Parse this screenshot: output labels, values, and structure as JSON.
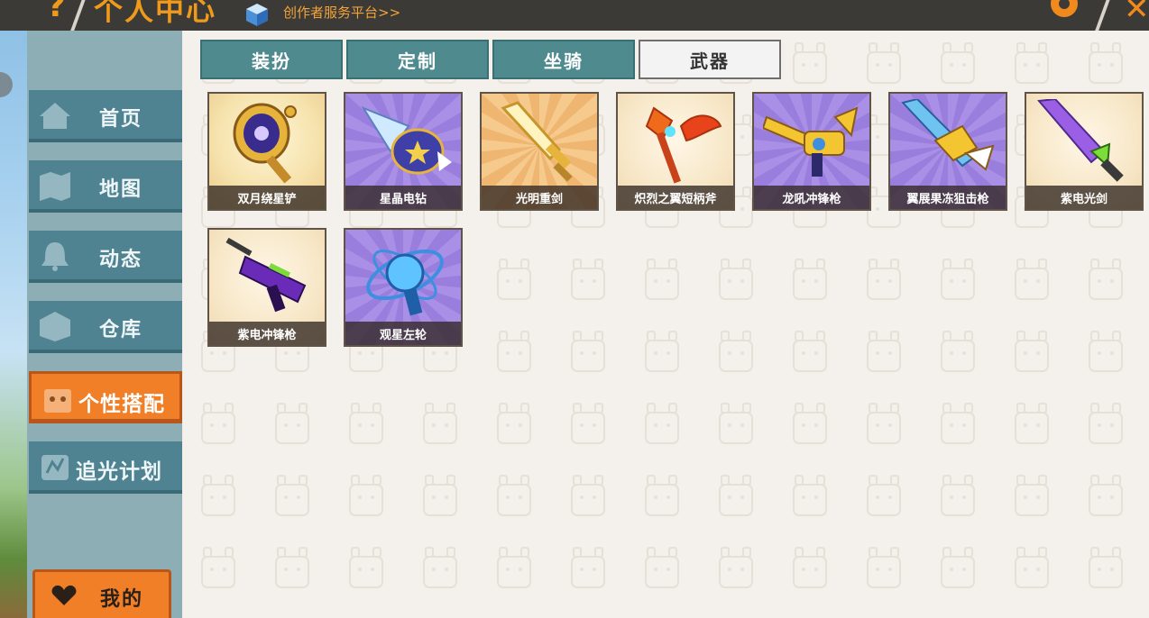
{
  "header": {
    "help_glyph": "?",
    "title": "个人中心",
    "creator_link": "创作者服务平台>>"
  },
  "sidebar": {
    "items": [
      {
        "label": "首页",
        "icon": "house-icon"
      },
      {
        "label": "地图",
        "icon": "map-icon"
      },
      {
        "label": "动态",
        "icon": "bell-icon"
      },
      {
        "label": "仓库",
        "icon": "box-icon"
      },
      {
        "label": "个性搭配",
        "icon": "avatar-icon",
        "active": true
      },
      {
        "label": "追光计划",
        "icon": "spark-icon"
      }
    ],
    "mine_label": "我的"
  },
  "tabs": [
    {
      "label": "装扮",
      "active": false
    },
    {
      "label": "定制",
      "active": false
    },
    {
      "label": "坐骑",
      "active": false
    },
    {
      "label": "武器",
      "active": true
    }
  ],
  "weapons": [
    {
      "name": "双月绕星铲"
    },
    {
      "name": "星晶电钻"
    },
    {
      "name": "光明重剑"
    },
    {
      "name": "炽烈之翼短柄斧"
    },
    {
      "name": "龙吼冲锋枪"
    },
    {
      "name": "翼展果冻狙击枪"
    },
    {
      "name": "紫电光剑"
    },
    {
      "name": "紫电冲锋枪"
    },
    {
      "name": "观星左轮"
    }
  ],
  "colors": {
    "accent": "#f07f28",
    "tab": "#4f8a8e",
    "nav": "#4f8392"
  }
}
